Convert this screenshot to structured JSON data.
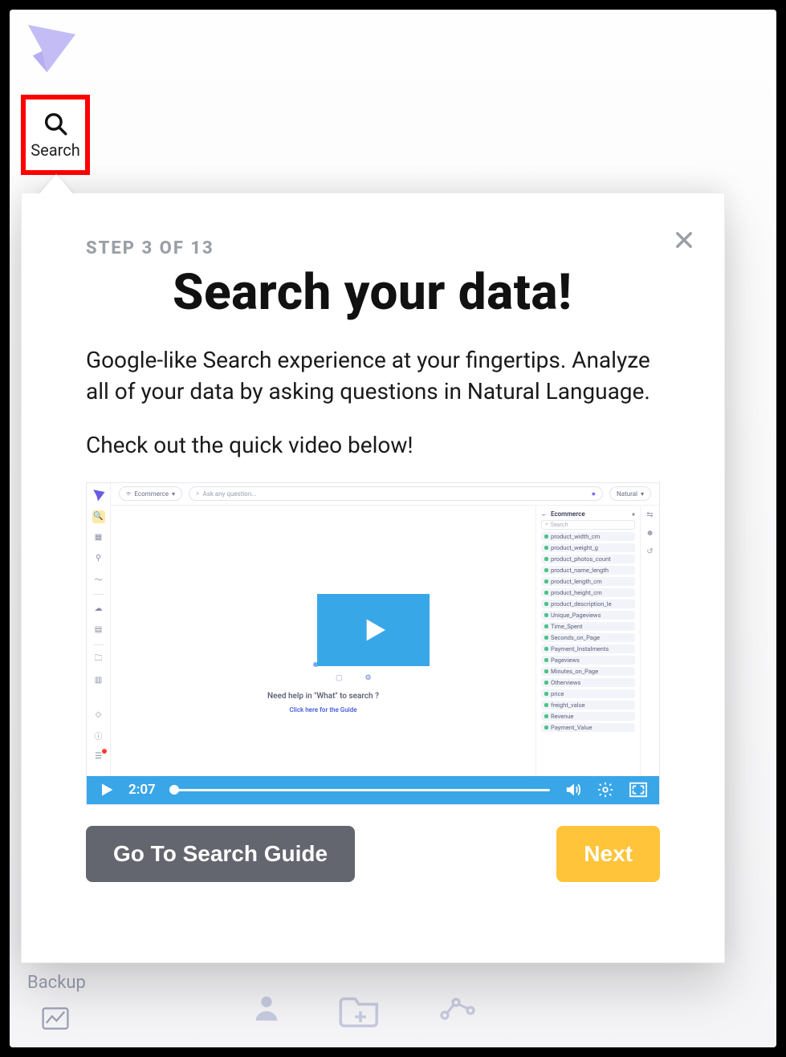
{
  "nav": {
    "search_label": "Search"
  },
  "popover": {
    "step_label": "STEP 3 OF 13",
    "title": "Search your data!",
    "body1": "Google-like Search experience at your fingertips. Analyze all of your data by asking questions in Natural Language.",
    "body2": "Check out the quick video below!",
    "secondary_button": "Go To Search Guide",
    "primary_button": "Next"
  },
  "video": {
    "time": "2:07",
    "topbar": {
      "source_chip": "Ecommerce",
      "search_placeholder": "Ask any question...",
      "mode_label": "Natural"
    },
    "canvas": {
      "help_text": "Need help in \"What\" to search ?",
      "guide_link": "Click here for the Guide"
    },
    "side": {
      "title": "Ecommerce",
      "search_placeholder": "Search",
      "items": [
        "product_width_cm",
        "product_weight_g",
        "product_photos_count",
        "product_name_length",
        "product_length_cm",
        "product_height_cm",
        "product_description_le",
        "Unique_Pageviews",
        "Time_Spent",
        "Seconds_on_Page",
        "Payment_Instalments",
        "Pageviews",
        "Minutes_on_Page",
        "Otherviews",
        "price",
        "freight_value",
        "Revenue",
        "Payment_Value"
      ]
    }
  },
  "background": {
    "ghost_text": "Backup"
  }
}
